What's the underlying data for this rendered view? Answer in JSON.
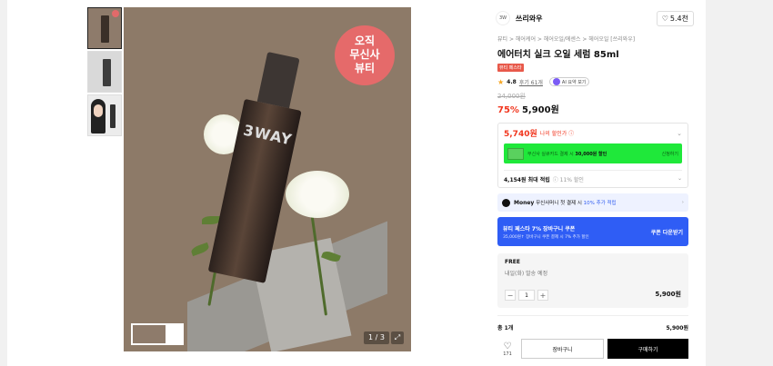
{
  "hero": {
    "badge_line1": "오직",
    "badge_line2": "무신사",
    "badge_line3": "뷰티",
    "bottle_text": "3WAY",
    "page_indicator": "1 / 3",
    "expand_icon": "expand-icon"
  },
  "brand": {
    "logo_text": "3W",
    "name": "쓰리와우",
    "like_count": "5.4천"
  },
  "breadcrumb": "뷰티 > 헤어케어 > 헤어오일/에센스 > 헤어오일 [쓰리와우]",
  "product": {
    "title": "에어터치 실크 오일 세럼 85ml",
    "tag": "뷰티 페스타",
    "rating": "4.8",
    "review_link": "후기 61개",
    "ai_label": "AI 요약 보기",
    "original_price": "24,000원",
    "discount": "75%",
    "price": "5,900원"
  },
  "benefit": {
    "max_price": "5,740원",
    "max_label": "나의 할인가 ⓘ",
    "card_text_prefix": "무신사 실큐카드 결제 시",
    "card_text_bold": "30,000원 할인",
    "card_apply": "신청하기",
    "points": "4,154원 최대 적립",
    "points_sub": "ⓘ 11% 할인"
  },
  "money": {
    "brand": "Money",
    "text": "무신사머니 첫 결제 시",
    "highlight": "10% 추가 적립"
  },
  "coupon": {
    "line1": "뷰티 페스타 7% 장바구니 쿠폰",
    "line2": "35,000원↑ 장바구니 쿠폰 결제 시 7% 추가 할인",
    "button": "쿠폰 다운받기"
  },
  "option": {
    "shipping_type": "FREE",
    "shipping_info": "내일(화) 발송 예정",
    "quantity": "1",
    "price": "5,900원"
  },
  "total": {
    "label": "총 1개",
    "price": "5,900원"
  },
  "actions": {
    "wish_count": "171",
    "cart": "장바구니",
    "buy": "구매하기"
  }
}
